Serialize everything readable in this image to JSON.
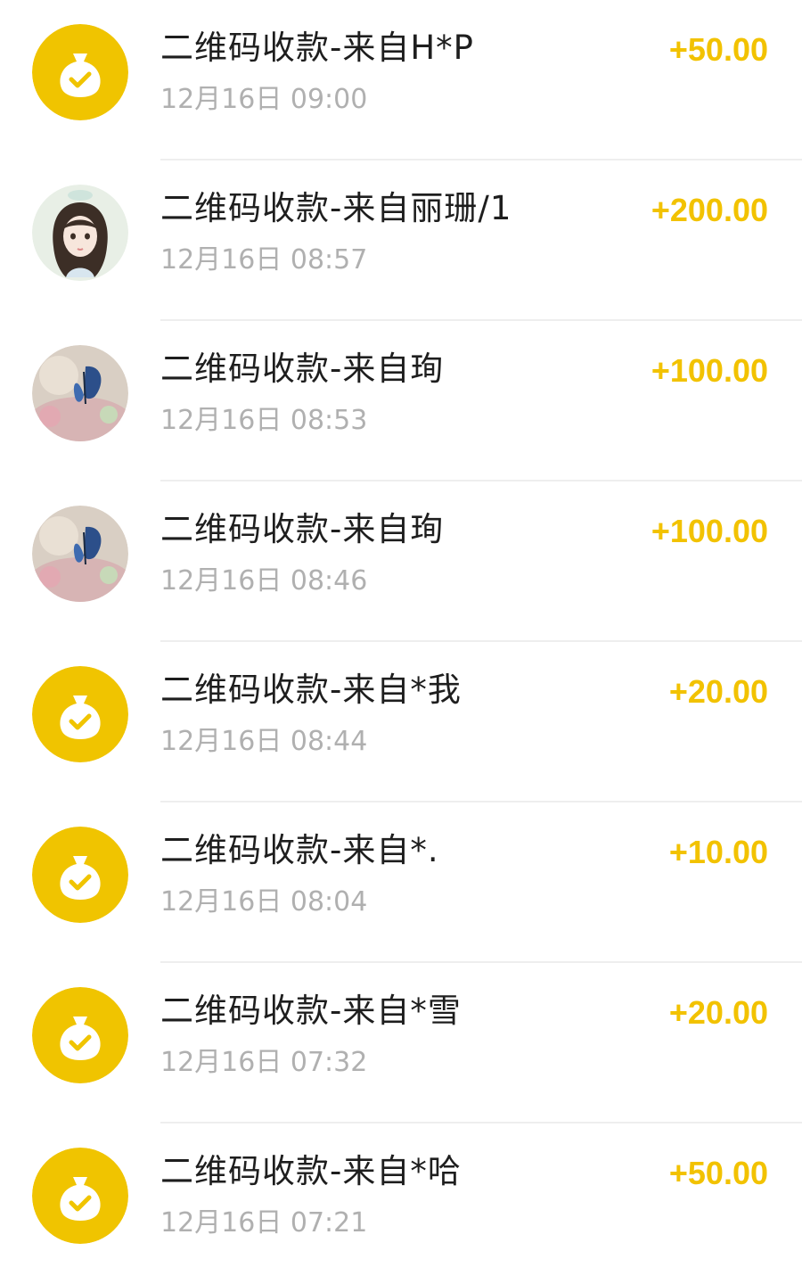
{
  "colors": {
    "accent": "#f2c200",
    "icon_bg": "#f0c400",
    "title": "#1e1e1e",
    "time": "#b0b0b0",
    "divider": "#eeeeee"
  },
  "transactions": [
    {
      "icon": "money-bag-check-icon",
      "title": "二维码收款-来自H*P",
      "time": "12月16日 09:00",
      "amount": "+50.00"
    },
    {
      "icon": "user-avatar-girl",
      "title": "二维码收款-来自丽珊/1",
      "time": "12月16日 08:57",
      "amount": "+200.00"
    },
    {
      "icon": "user-avatar-butterfly",
      "title": "二维码收款-来自珣",
      "time": "12月16日 08:53",
      "amount": "+100.00"
    },
    {
      "icon": "user-avatar-butterfly",
      "title": "二维码收款-来自珣",
      "time": "12月16日 08:46",
      "amount": "+100.00"
    },
    {
      "icon": "money-bag-check-icon",
      "title": "二维码收款-来自*我",
      "time": "12月16日 08:44",
      "amount": "+20.00"
    },
    {
      "icon": "money-bag-check-icon",
      "title": "二维码收款-来自*.",
      "time": "12月16日 08:04",
      "amount": "+10.00"
    },
    {
      "icon": "money-bag-check-icon",
      "title": "二维码收款-来自*雪",
      "time": "12月16日 07:32",
      "amount": "+20.00"
    },
    {
      "icon": "money-bag-check-icon",
      "title": "二维码收款-来自*哈",
      "time": "12月16日 07:21",
      "amount": "+50.00"
    }
  ]
}
